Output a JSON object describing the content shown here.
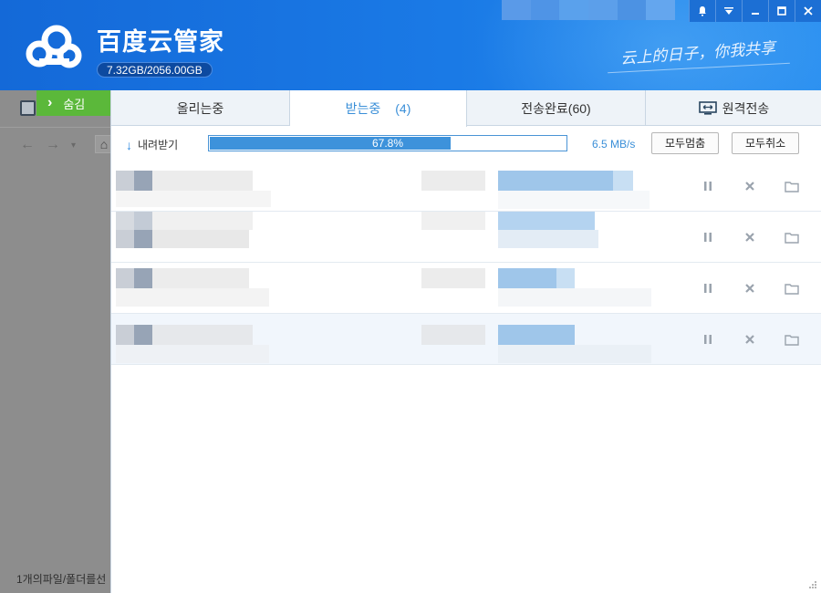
{
  "app": {
    "title": "百度云管家",
    "quota": "7.32GB/2056.00GB",
    "slogan": "云上的日子，你我共享"
  },
  "colors": {
    "header": "#1a7ae6",
    "accent": "#3a8fd8",
    "hide_button": "#5bb83a"
  },
  "left_panel": {
    "hide_button": "숨김",
    "status": "1개의파일/폴더를선"
  },
  "tabs": [
    {
      "label": "올리는중"
    },
    {
      "label": "받는중",
      "count": "(4)"
    },
    {
      "label": "전송완료(60)"
    },
    {
      "label": "원격전송",
      "icon": "monitor-icon"
    }
  ],
  "toolbar": {
    "download_label": "내려받기",
    "progress_text": "67.8%",
    "progress_value": 0.678,
    "speed": "6.5 MB/s",
    "pause_all": "모두멈춤",
    "cancel_all": "모두취소"
  },
  "rows": [
    {
      "icons": [
        "pause-icon",
        "close-icon",
        "folder-icon"
      ]
    },
    {
      "icons": [
        "pause-icon",
        "close-icon",
        "folder-icon"
      ]
    },
    {
      "icons": [
        "pause-icon",
        "close-icon",
        "folder-icon"
      ]
    },
    {
      "icons": [
        "pause-icon",
        "close-icon",
        "folder-icon"
      ]
    }
  ]
}
